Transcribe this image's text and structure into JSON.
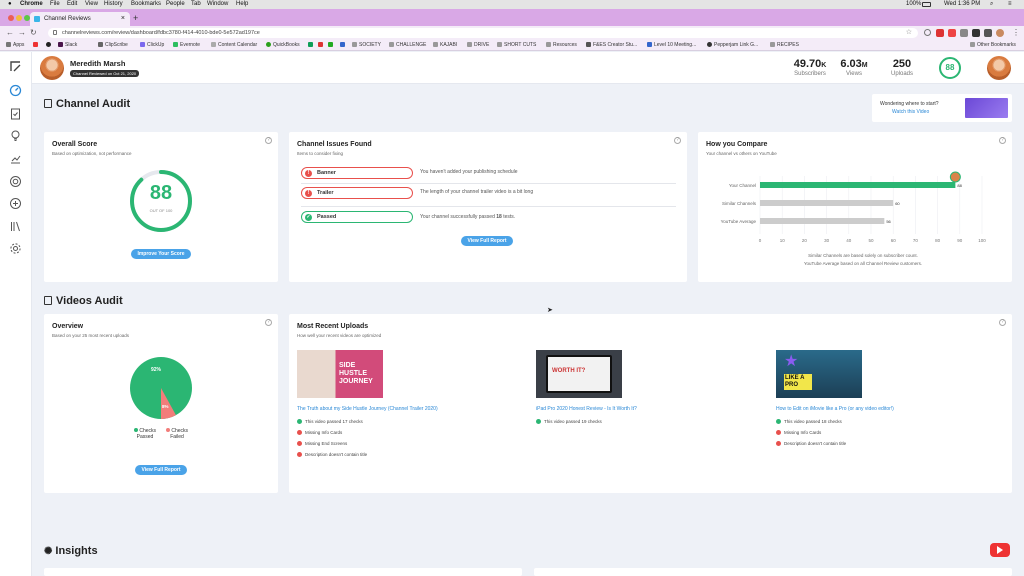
{
  "menubar": {
    "app": "Chrome",
    "items": [
      "File",
      "Edit",
      "View",
      "History",
      "Bookmarks",
      "People",
      "Tab",
      "Window",
      "Help"
    ],
    "battery": "100%",
    "clock": "Wed 1:36 PM"
  },
  "browser": {
    "tab_title": "Channel Reviews",
    "new_tab": "+",
    "url": "channelreviews.com/review/dashboard/fdbc3780-f414-4010-bde0-5e572ad197ce",
    "bookmarks": [
      "Apps",
      "",
      "Slack",
      "ClipScribe",
      "ClickUp",
      "Evernote",
      "Content Calendar",
      "QuickBooks",
      "",
      "",
      "",
      "",
      "SOCIETY",
      "CHALLENGE",
      "KAJABI",
      "DRIVE",
      "SHORT CUTS",
      "Resources",
      "F&ES Creator Stu...",
      "Level 10 Meeting...",
      "Pepperjam Link G...",
      "RECIPES"
    ],
    "other_bookmarks": "Other Bookmarks"
  },
  "header": {
    "user_name": "Meredith Marsh",
    "reviewed_badge": "Channel Reviewed on Oct 21, 2020",
    "stats": [
      {
        "value": "49.70",
        "unit": "K",
        "label": "Subscribers"
      },
      {
        "value": "6.03",
        "unit": "M",
        "label": "Views"
      },
      {
        "value": "250",
        "unit": "",
        "label": "Uploads"
      }
    ],
    "score": "88"
  },
  "channel_audit": {
    "title": "Channel Audit",
    "promo": {
      "line1": "Wondering where to start?",
      "link": "Watch this Video"
    },
    "overall": {
      "title": "Overall Score",
      "subtitle": "Based on optimization, not performance",
      "score": 88,
      "max": 100,
      "out_of": "OUT OF 100",
      "button": "Improve Your Score"
    },
    "issues": {
      "title": "Channel Issues Found",
      "subtitle": "Items to consider fixing",
      "items": [
        {
          "label": "Banner",
          "status": "fail",
          "text": "You haven't added your publishing schedule"
        },
        {
          "label": "Trailer",
          "status": "fail",
          "text": "The length of your channel trailer video is a bit long"
        },
        {
          "label": "Passed",
          "status": "pass",
          "text_prefix": "Your channel successfully passed ",
          "count": "18",
          "text_suffix": " tests."
        }
      ],
      "button": "View Full Report"
    },
    "compare": {
      "title": "How you Compare",
      "subtitle": "Your channel vs others on YouTube",
      "note1": "Similar Channels are based solely on subscriber count.",
      "note2": "YouTube Average based on all Channel Review customers."
    }
  },
  "chart_data": {
    "type": "bar",
    "orientation": "horizontal",
    "categories": [
      "Your Channel",
      "Similar Channels",
      "YouTube Average"
    ],
    "values": [
      88,
      60,
      56
    ],
    "colors": [
      "#2bb673",
      "#cccccc",
      "#cccccc"
    ],
    "xlim": [
      0,
      100
    ],
    "xticks": [
      0,
      10,
      20,
      30,
      40,
      50,
      60,
      70,
      80,
      90,
      100
    ]
  },
  "videos_audit": {
    "title": "Videos Audit",
    "overview": {
      "title": "Overview",
      "subtitle": "Based on your 25 most recent uploads",
      "passed_pct": 92,
      "failed_pct": 8,
      "passed_label": "92%",
      "failed_label": "8%",
      "legend_passed": "Checks Passed",
      "legend_failed": "Checks Failed",
      "button": "View Full Report"
    },
    "uploads": {
      "title": "Most Recent Uploads",
      "subtitle": "How well your recent videos are optimized",
      "videos": [
        {
          "thumb_text": "SIDE HUSTLE JOURNEY",
          "title": "The Truth about my Side Hustle Journey (Channel Trailer 2020)",
          "checks": [
            {
              "ok": true,
              "text": "This video passed 17 checks"
            },
            {
              "ok": false,
              "text": "Missing Info Cards"
            },
            {
              "ok": false,
              "text": "Missing End Screens"
            },
            {
              "ok": false,
              "text": "Description doesn't contain title"
            }
          ]
        },
        {
          "thumb_text": "WORTH IT?",
          "title": "iPad Pro 2020 Honest Review - Is It Worth It?",
          "checks": [
            {
              "ok": true,
              "text": "This video passed 19 checks"
            }
          ]
        },
        {
          "thumb_text": "LIKE A PRO",
          "title": "How to Edit on iMovie like a Pro (or any video editor!)",
          "checks": [
            {
              "ok": true,
              "text": "This video passed 18 checks"
            },
            {
              "ok": false,
              "text": "Missing Info Cards"
            },
            {
              "ok": false,
              "text": "Description doesn't contain title"
            }
          ]
        }
      ]
    }
  },
  "insights": {
    "title": "Insights"
  },
  "colors": {
    "accent_green": "#2bb673",
    "button_blue": "#4aa3e8",
    "fail_red": "#e8504c",
    "link_blue": "#2a88d6",
    "tab_purple": "#d9a8e6"
  }
}
